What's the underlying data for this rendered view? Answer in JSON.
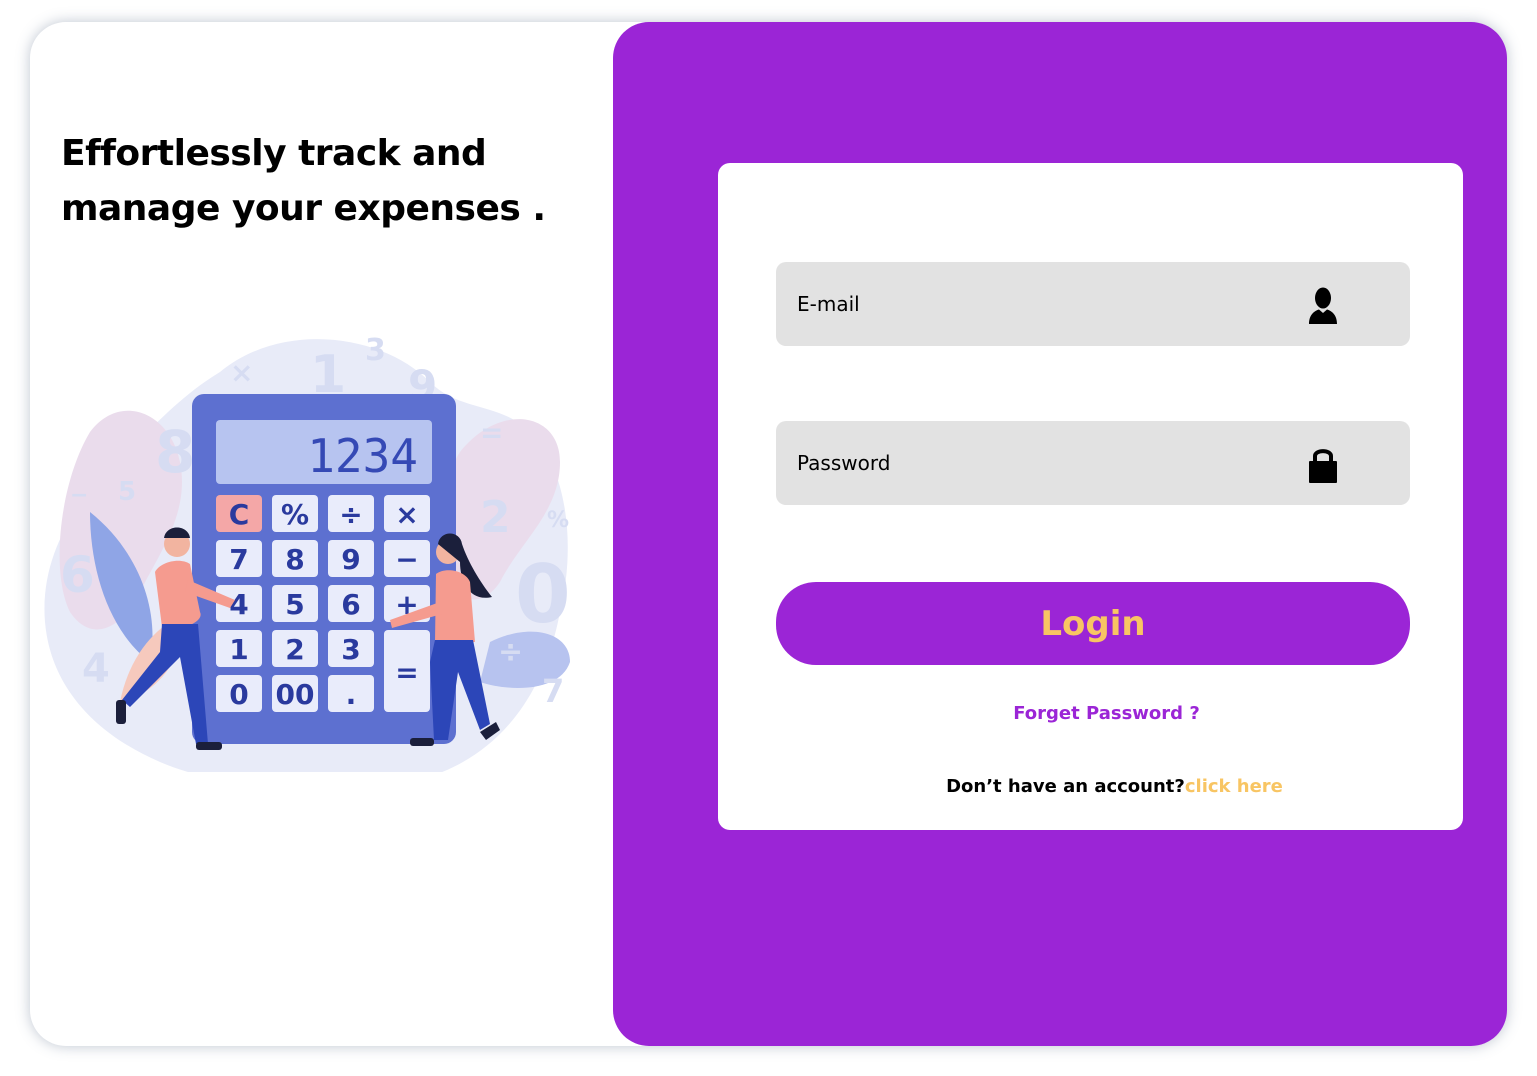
{
  "hero": {
    "headline": "Effortlessly track and manage your expenses .",
    "calculator": {
      "display": "1234",
      "keys": [
        "C",
        "%",
        "÷",
        "×",
        "7",
        "8",
        "9",
        "−",
        "4",
        "5",
        "6",
        "+",
        "1",
        "2",
        "3",
        "=",
        "0",
        "00",
        "."
      ]
    }
  },
  "login_form": {
    "email_placeholder": "E-mail",
    "email_icon": "user-icon",
    "password_placeholder": "Password",
    "password_icon": "lock-icon",
    "login_label": "Login",
    "forgot_password": "Forget Password ?",
    "no_account_text": "Don’t have an account?",
    "signup_link": "click here"
  },
  "colors": {
    "brand_purple": "#9b25d6",
    "accent_yellow": "#f8c563",
    "field_gray": "#e2e2e2"
  }
}
